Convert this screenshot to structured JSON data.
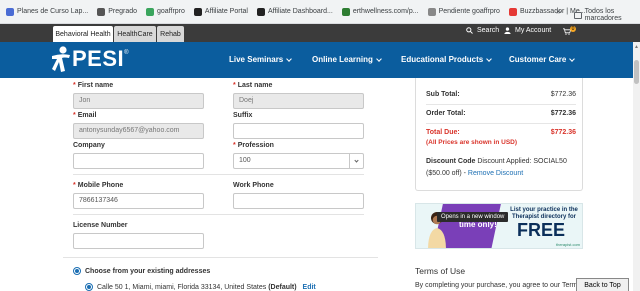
{
  "bookmarks": {
    "items": [
      {
        "label": "Planes de Curso Lap...",
        "color": "#4a6cd4"
      },
      {
        "label": "Pregrado",
        "color": "#555555"
      },
      {
        "label": "goaffrpro",
        "color": "#3aa55d"
      },
      {
        "label": "Affiliate Portal",
        "color": "#222222"
      },
      {
        "label": "Affiliate Dashboard...",
        "color": "#222222"
      },
      {
        "label": "erthwellness.com/p...",
        "color": "#2e7d32"
      },
      {
        "label": "Pendiente goaffrpro",
        "color": "#888888"
      },
      {
        "label": "Buzzbassador | Me...",
        "color": "#e53935"
      }
    ],
    "more": "»",
    "folder_label": "Todos los marcadores"
  },
  "utility": {
    "tabs": [
      "Behavioral Health",
      "HealthCare",
      "Rehab"
    ],
    "search": "Search",
    "account": "My Account",
    "cart_count": "0"
  },
  "nav": {
    "logo": "PESI",
    "logo_mark": "®",
    "items": [
      "Live Seminars",
      "Online Learning",
      "Educational Products",
      "Customer Care"
    ]
  },
  "form": {
    "first_name_label": "First name",
    "first_name_value": "Jon",
    "last_name_label": "Last name",
    "last_name_value": "Doej",
    "email_label": "Email",
    "email_value": "antonysunday6567@yahoo.com",
    "suffix_label": "Suffix",
    "suffix_value": "",
    "company_label": "Company",
    "company_value": "",
    "profession_label": "Profession",
    "profession_value": "100",
    "mobile_label": "Mobile Phone",
    "mobile_value": "7866137346",
    "work_label": "Work Phone",
    "work_value": "",
    "license_label": "License Number",
    "license_value": "",
    "address_choice": "Choose from your existing addresses",
    "address_line": "Calle 50 1, Miami, miami, Florida 33134, United States",
    "address_default": "(Default)",
    "address_edit": "Edit"
  },
  "summary": {
    "subtotal_label": "Sub Total:",
    "subtotal_value": "$772.36",
    "order_total_label": "Order Total:",
    "order_total_value": "$772.36",
    "total_due_label": "Total Due:",
    "total_due_value": "$772.36",
    "usd_note": "(All Prices are shown in USD)",
    "discount_label": "Discount Code",
    "discount_text": "Discount Applied: SOCIAL50",
    "discount_amount": "($50.00 off) -",
    "remove_discount": "Remove Discount"
  },
  "ad": {
    "time_text": "time only!",
    "title": "List your practice in the Therapist directory for",
    "free": "FREE",
    "brand": "therapist.com",
    "tooltip": "Opens in a new window"
  },
  "terms": {
    "title": "Terms of Use",
    "text": "By completing your purchase, you agree to our Terms o"
  },
  "back_to_top": "Back to Top",
  "colors": {
    "nav_blue": "#0b5d9e",
    "required_red": "#d9342b",
    "link_blue": "#1c6fb3",
    "ad_purple": "#7a3fb8"
  }
}
